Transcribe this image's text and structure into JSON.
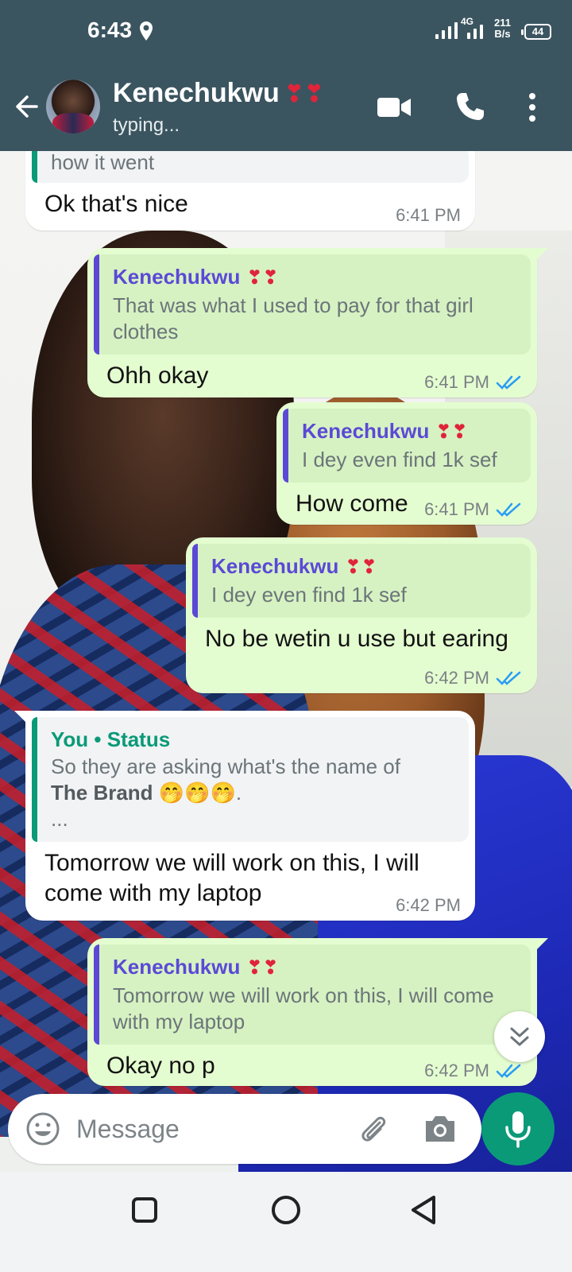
{
  "status_bar": {
    "time": "6:43",
    "network": "4G",
    "speed_value": "211",
    "speed_unit": "B/s",
    "battery": "44"
  },
  "header": {
    "contact_name": "Kenechukwu",
    "contact_hearts": "❣❣",
    "status": "typing..."
  },
  "messages": [
    {
      "direction": "in",
      "quote": {
        "text": "how it went"
      },
      "text": "Ok that's nice",
      "time": "6:41 PM"
    },
    {
      "direction": "out",
      "quote": {
        "author": "Kenechukwu",
        "hearts": "❣❣",
        "text": "That was what I used to pay for that girl clothes"
      },
      "text": "Ohh okay",
      "time": "6:41 PM",
      "read": true
    },
    {
      "direction": "out",
      "quote": {
        "author": "Kenechukwu",
        "hearts": "❣❣",
        "text": "I dey even find 1k sef"
      },
      "text": "How come",
      "time": "6:41 PM",
      "read": true
    },
    {
      "direction": "out",
      "quote": {
        "author": "Kenechukwu",
        "hearts": "❣❣",
        "text": "I dey even find 1k sef"
      },
      "text": "No be wetin u use but earing",
      "time": "6:42 PM",
      "read": true
    },
    {
      "direction": "in",
      "quote": {
        "author": "You • Status",
        "text_before": "So they are asking what's the name of",
        "text_bold": "The Brand",
        "emojis": "🤭🤭🤭.",
        "more": "..."
      },
      "text": "Tomorrow we will work on this, I will come with my laptop",
      "time": "6:42 PM"
    },
    {
      "direction": "out",
      "quote": {
        "author": "Kenechukwu",
        "hearts": "❣❣",
        "text": "Tomorrow we will work on this, I will come with my laptop"
      },
      "text": "Okay no p",
      "time": "6:42 PM",
      "read": true
    }
  ],
  "input": {
    "placeholder": "Message"
  },
  "colors": {
    "header": "#3b5560",
    "outgoing": "#e4fdd0",
    "incoming": "#ffffff",
    "accent": "#0b9a78",
    "quote_author": "#5b49d6",
    "read_ticks": "#2a9df4"
  },
  "icons": [
    "back-arrow-icon",
    "video-call-icon",
    "voice-call-icon",
    "more-options-icon",
    "emoji-icon",
    "attach-icon",
    "camera-icon",
    "mic-icon",
    "scroll-down-icon"
  ]
}
